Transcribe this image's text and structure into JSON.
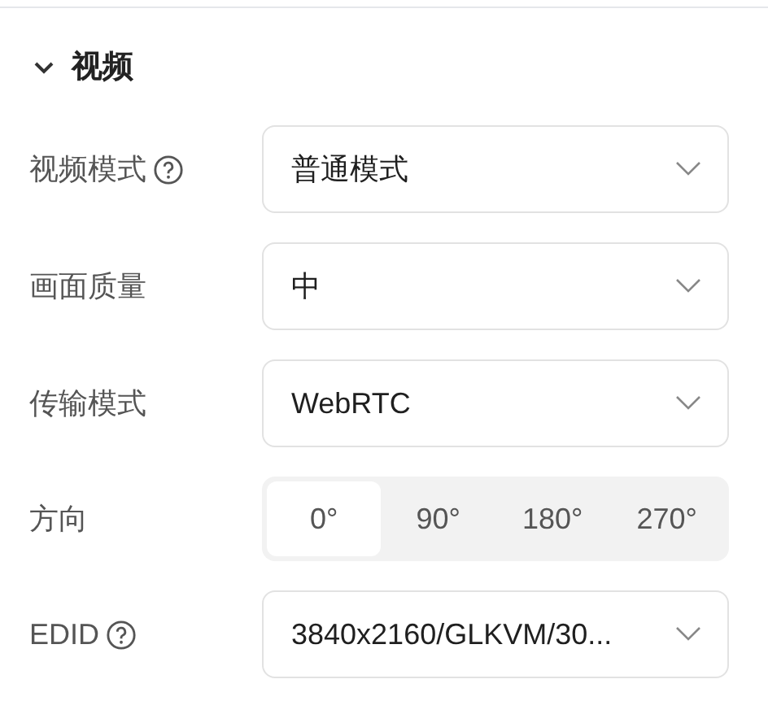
{
  "section": {
    "title": "视频",
    "expanded": true
  },
  "rows": [
    {
      "kind": "select",
      "label": "视频模式",
      "help": true,
      "value": "普通模式"
    },
    {
      "kind": "select",
      "label": "画面质量",
      "help": false,
      "value": "中"
    },
    {
      "kind": "select",
      "label": "传输模式",
      "help": false,
      "value": "WebRTC"
    },
    {
      "kind": "segmented",
      "label": "方向",
      "help": false,
      "options": [
        {
          "label": "0°",
          "selected": true
        },
        {
          "label": "90°",
          "selected": false
        },
        {
          "label": "180°",
          "selected": false
        },
        {
          "label": "270°",
          "selected": false
        }
      ]
    },
    {
      "kind": "select",
      "label": "EDID",
      "help": true,
      "value": "3840x2160/GLKVM/30..."
    }
  ]
}
